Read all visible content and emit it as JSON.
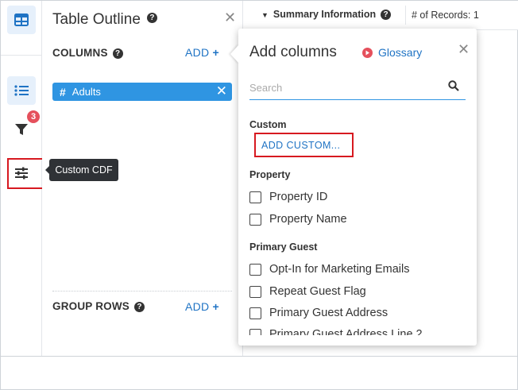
{
  "sidebar": {
    "icons": [
      "table-icon",
      "list-icon",
      "filter-icon",
      "sliders-icon"
    ],
    "filter_badge": "3",
    "tooltip": "Custom CDF"
  },
  "outline": {
    "title": "Table Outline",
    "help_glyph": "?",
    "close_glyph": "✕",
    "columns_label": "COLUMNS",
    "add_label": "ADD",
    "add_glyph": "+",
    "column_pills": [
      {
        "glyph": "#",
        "label": "Adults",
        "remove_glyph": "✕"
      }
    ],
    "group_rows_label": "GROUP ROWS"
  },
  "summary": {
    "chevron": "▼",
    "label": "Summary Information",
    "records": "# of Records: 1"
  },
  "popover": {
    "title": "Add columns",
    "glossary_label": "Glossary",
    "close_glyph": "✕",
    "search_placeholder": "Search",
    "custom_group": "Custom",
    "add_custom_label": "ADD CUSTOM...",
    "property_group": "Property",
    "property_items": [
      "Property ID",
      "Property Name"
    ],
    "guest_group": "Primary Guest",
    "guest_items": [
      "Opt-In for Marketing Emails",
      "Repeat Guest Flag",
      "Primary Guest Address",
      "Primary Guest Address Line 2"
    ]
  },
  "colors": {
    "accent": "#1f73c4",
    "pill": "#2f95e2",
    "badge": "#e5505c",
    "highlight": "#d71920"
  }
}
